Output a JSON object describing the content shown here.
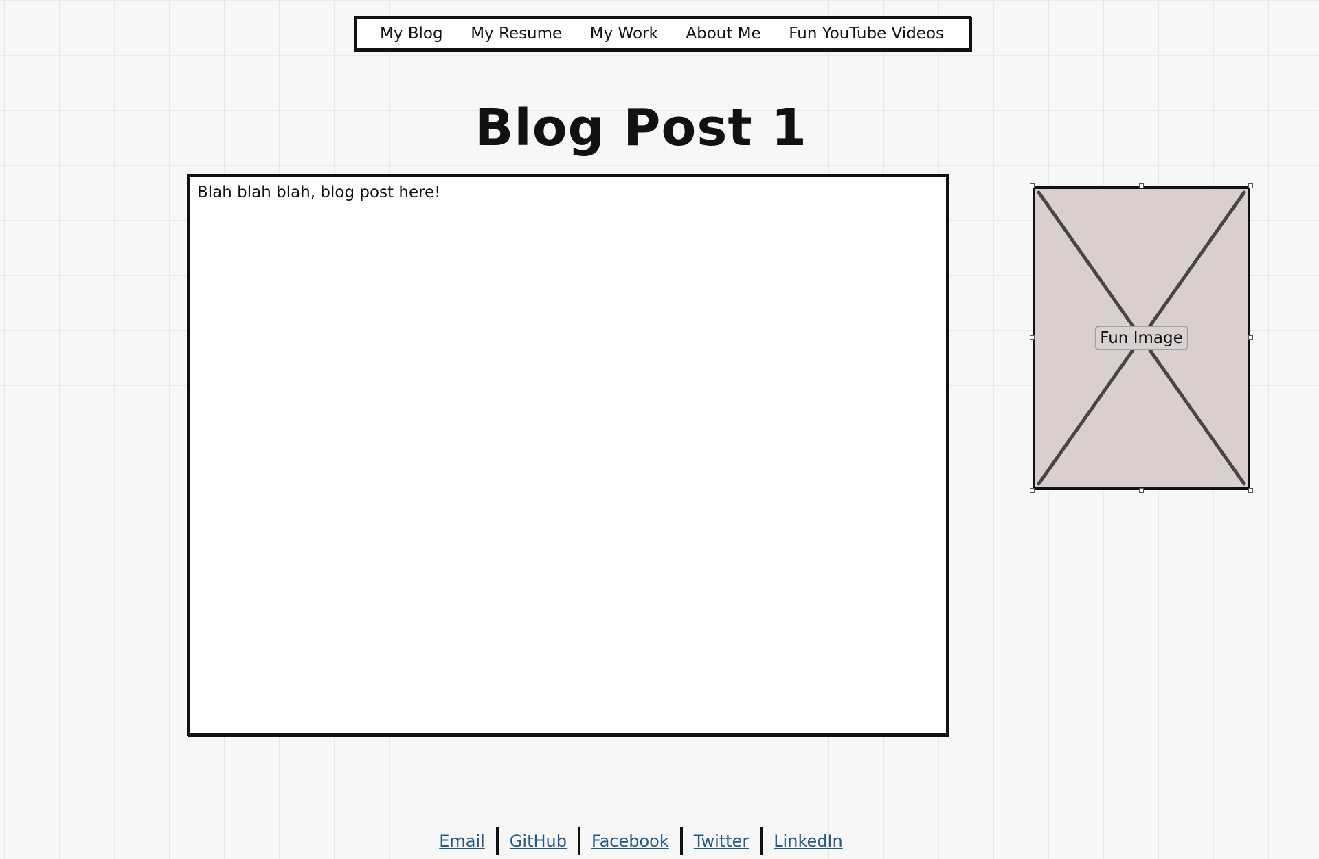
{
  "nav": {
    "items": [
      {
        "label": "My Blog"
      },
      {
        "label": "My Resume"
      },
      {
        "label": "My Work"
      },
      {
        "label": "About Me"
      },
      {
        "label": "Fun YouTube Videos"
      }
    ]
  },
  "main": {
    "title": "Blog Post 1",
    "post_text": "Blah blah blah, blog post here!"
  },
  "sidebar": {
    "image_label": "Fun Image"
  },
  "footer": {
    "links": [
      {
        "label": "Email"
      },
      {
        "label": "GitHub"
      },
      {
        "label": "Facebook"
      },
      {
        "label": "Twitter"
      },
      {
        "label": "LinkedIn"
      }
    ]
  },
  "colors": {
    "background": "#f7f7f7",
    "grid": "#e9e9e9",
    "border": "#111111",
    "link": "#1f5a8c",
    "image_fill": "#d9cfcf",
    "image_cross": "#4a4444"
  }
}
